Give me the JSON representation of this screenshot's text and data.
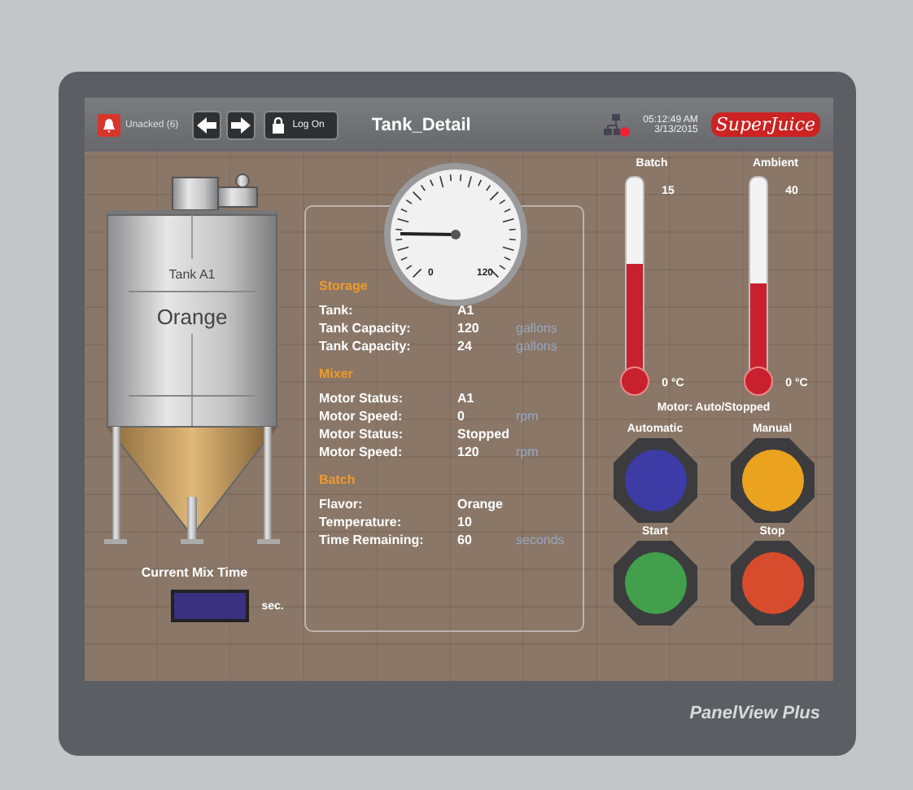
{
  "header": {
    "alarm": {
      "label": "Unacked (6)"
    },
    "login": {
      "label": "Log On"
    },
    "title": "Tank_Detail",
    "time": "05:12:49 AM",
    "date": "3/13/2015",
    "logo": "SuperJuice"
  },
  "tank": {
    "label": "Tank A1",
    "contents": "Orange",
    "mix_time": {
      "label": "Current Mix Time",
      "unit": "sec."
    }
  },
  "gauge": {
    "min": "0",
    "max": "120",
    "level": 0.17
  },
  "sections": [
    {
      "title": "Storage",
      "rows": [
        {
          "label": "Tank:",
          "value": "A1"
        },
        {
          "label": "Tank Capacity:",
          "value": "120",
          "unit": "gallons"
        },
        {
          "label": "Tank Capacity:",
          "value": "24",
          "unit": "gallons"
        }
      ]
    },
    {
      "title": "Mixer",
      "rows": [
        {
          "label": "Motor Status:",
          "value": "A1"
        },
        {
          "label": "Motor Speed:",
          "value": "0",
          "unit": "rpm"
        },
        {
          "label": "Motor Status:",
          "value": "Stopped"
        },
        {
          "label": "Motor Speed:",
          "value": "120",
          "unit": "rpm"
        }
      ]
    },
    {
      "title": "Batch",
      "rows": [
        {
          "label": "Flavor:",
          "value": "Orange"
        },
        {
          "label": "Temperature:",
          "value": "10"
        },
        {
          "label": "Time Remaining:",
          "value": "60",
          "unit": "seconds"
        }
      ]
    }
  ],
  "thermometers": [
    {
      "label": "Batch",
      "max": "15",
      "min": "0 °C",
      "level": 0.55
    },
    {
      "label": "Ambient",
      "max": "40",
      "min": "0 °C",
      "level": 0.45
    }
  ],
  "motor_status": "Motor: Auto/Stopped",
  "buttons": [
    {
      "label": "Automatic",
      "color": "#3d3ba6"
    },
    {
      "label": "Manual",
      "color": "#eba21e"
    },
    {
      "label": "Start",
      "color": "#42a04c"
    },
    {
      "label": "Stop",
      "color": "#d84c2e"
    }
  ],
  "brand": "PanelView Plus"
}
